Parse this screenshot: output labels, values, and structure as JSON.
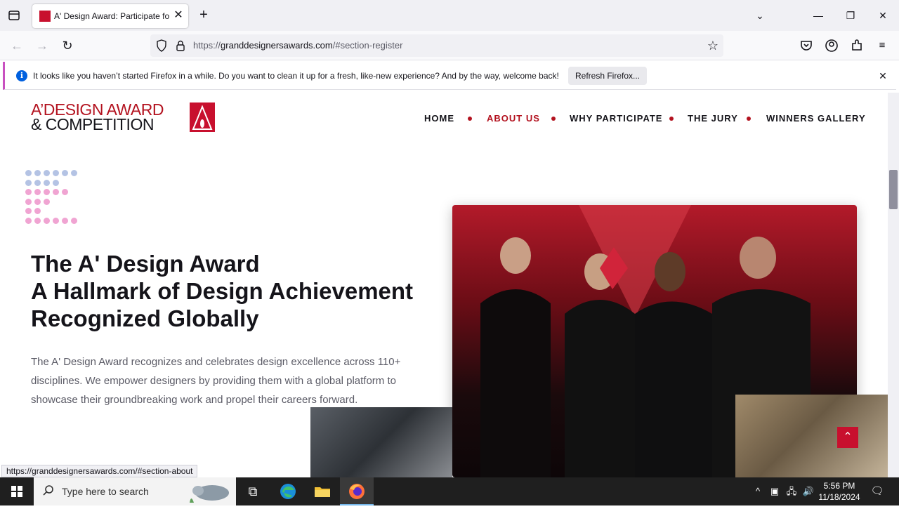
{
  "browser": {
    "tab": {
      "title": "A' Design Award: Participate fo",
      "close": "✕"
    },
    "new_tab": "+",
    "url": {
      "scheme": "https://",
      "host": "granddesignersawards.com",
      "path": "/#section-register"
    },
    "notification": {
      "icon": "i",
      "message": "It looks like you haven’t started Firefox in a while. Do you want to clean it up for a fresh, like-new experience? And by the way, welcome back!",
      "button": "Refresh Firefox...",
      "close": "✕"
    },
    "status_url": "https://granddesignersawards.com/#section-about"
  },
  "site": {
    "logo": {
      "line1": "A’DESIGN AWARD",
      "line2": "& COMPETITION"
    },
    "nav": [
      "HOME",
      "ABOUT US",
      "WHY PARTICIPATE",
      "THE JURY",
      "WINNERS GALLERY"
    ],
    "hero": {
      "title_lines": [
        "The A' Design Award",
        "A Hallmark of Design Achievement",
        "Recognized Globally"
      ],
      "description": "The A' Design Award recognizes and celebrates design excellence across 110+ disciplines. We empower designers by providing them with a global platform to showcase their groundbreaking work and propel their careers forward."
    },
    "back_to_top": "⌃"
  },
  "taskbar": {
    "search_placeholder": "Type here to search",
    "time": "5:56 PM",
    "date": "11/18/2024"
  },
  "colors": {
    "brand_red": "#b3121f",
    "dot_blue": "#b4c3e4",
    "dot_pink": "#f0a4d2"
  }
}
